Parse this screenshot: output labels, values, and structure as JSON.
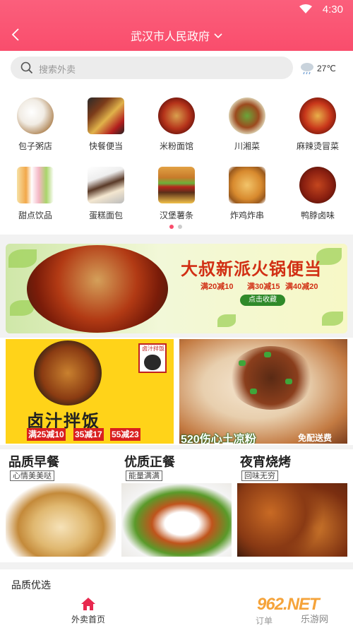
{
  "status": {
    "time": "4:30"
  },
  "header": {
    "location": "武汉市人民政府"
  },
  "search": {
    "placeholder": "搜索外卖"
  },
  "weather": {
    "temp": "27℃"
  },
  "categories": [
    {
      "label": "包子粥店"
    },
    {
      "label": "快餐便当"
    },
    {
      "label": "米粉面馆"
    },
    {
      "label": "川湘菜"
    },
    {
      "label": "麻辣烫冒菜"
    },
    {
      "label": "甜点饮品"
    },
    {
      "label": "蛋糕面包"
    },
    {
      "label": "汉堡薯条"
    },
    {
      "label": "炸鸡炸串"
    },
    {
      "label": "鸭脖卤味"
    }
  ],
  "pager": {
    "page": 1,
    "pages": 2
  },
  "banner_hotpot": {
    "title": "大叔新派火锅便当",
    "deals": [
      "满20减10",
      "满30减15",
      "满40减20"
    ],
    "button": "点击收藏"
  },
  "banner_rice": {
    "logo": "卤汁拌饭",
    "name": "卤汁拌饭",
    "tags": [
      "满25减10",
      "35减17",
      "55减23"
    ]
  },
  "banner_noodle": {
    "name": "520伤心土凉粉",
    "note": "免配送费"
  },
  "meals": [
    {
      "title": "品质早餐",
      "subtitle": "心情美美哒"
    },
    {
      "title": "优质正餐",
      "subtitle": "能量满满"
    },
    {
      "title": "夜宵烧烤",
      "subtitle": "回味无穷"
    }
  ],
  "section": {
    "title": "品质优选"
  },
  "tabbar": {
    "home": "外卖首页",
    "order": "订单"
  },
  "watermark": {
    "logo": "962.NET",
    "site": "乐游网"
  },
  "colors": {
    "brand": "#f94d6c",
    "accent_red": "#d91f1f",
    "green": "#2f8a2a",
    "yellow": "#ffd319"
  }
}
